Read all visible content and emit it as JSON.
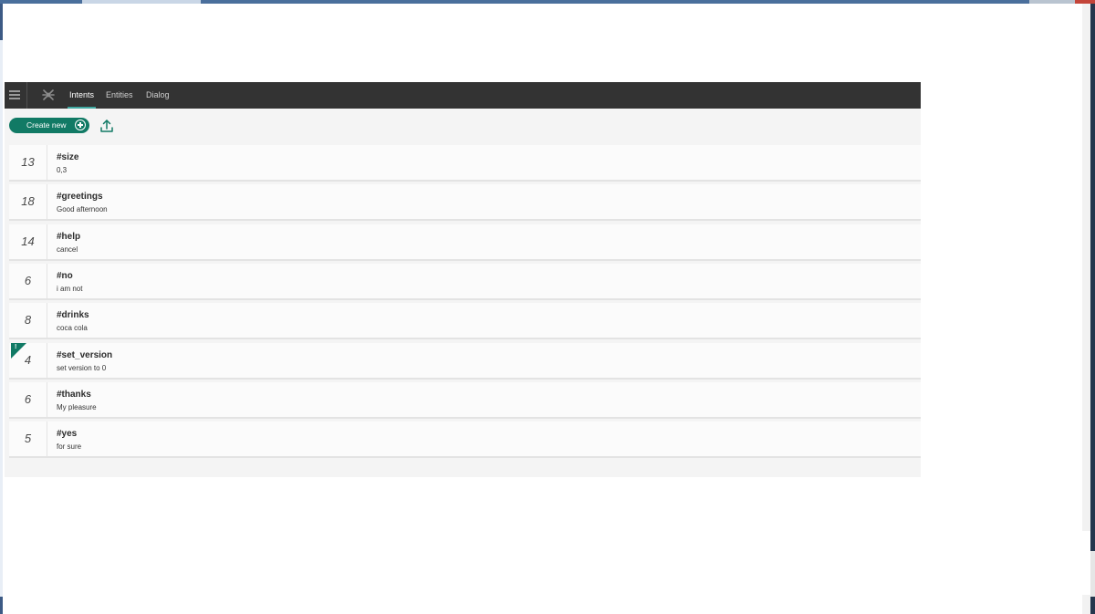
{
  "topbar": {
    "tabs": [
      {
        "label": "Intents",
        "active": true
      },
      {
        "label": "Entities",
        "active": false
      },
      {
        "label": "Dialog",
        "active": false
      }
    ]
  },
  "toolbar": {
    "create_label": "Create new"
  },
  "icons": {
    "menu": "hamburger-icon",
    "logo": "watson-logo-icon",
    "create": "plus-circle-icon",
    "upload": "upload-icon"
  },
  "colors": {
    "accent": "#117a65",
    "topbar": "#333333",
    "tab_underline": "#3fa8a0"
  },
  "intents": [
    {
      "count": "13",
      "name": "#size",
      "example": "0,3"
    },
    {
      "count": "18",
      "name": "#greetings",
      "example": "Good afternoon"
    },
    {
      "count": "14",
      "name": "#help",
      "example": "cancel"
    },
    {
      "count": "6",
      "name": "#no",
      "example": "i am not"
    },
    {
      "count": "8",
      "name": "#drinks",
      "example": "coca cola"
    },
    {
      "count": "4",
      "name": "#set_version",
      "example": "set version to 0",
      "flag": "!"
    },
    {
      "count": "6",
      "name": "#thanks",
      "example": "My pleasure"
    },
    {
      "count": "5",
      "name": "#yes",
      "example": "for sure"
    }
  ]
}
